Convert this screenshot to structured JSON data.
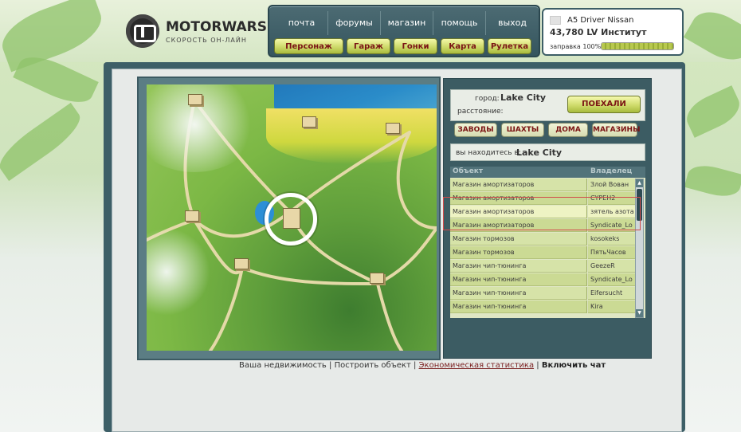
{
  "logo": {
    "title": "MOTORWARS.RU",
    "subtitle": "СКОРОСТЬ ОН-ЛАЙН"
  },
  "nav": {
    "top": [
      "почта",
      "форумы",
      "магазин",
      "помощь",
      "выход"
    ],
    "bottom": [
      "Персонаж",
      "Гараж",
      "Гонки",
      "Карта",
      "Рулетка"
    ]
  },
  "player": {
    "car": "A5 Driver Nissan",
    "money": "43,780 LV Институт",
    "fuel_label": "заправка 100%",
    "fuel_percent": 100
  },
  "city": {
    "city_label": "город:",
    "city_value": "Lake City",
    "distance_label": "расстояние:",
    "go_button": "ПОЕХАЛИ"
  },
  "categories": [
    "ЗАВОДЫ",
    "ШАХТЫ",
    "ДОМА",
    "МАГАЗИНЫ"
  ],
  "location": {
    "label": "вы находитесь в:",
    "value": "Lake City"
  },
  "table": {
    "headers": {
      "object": "Объект",
      "owner": "Владелец"
    },
    "rows": [
      {
        "object": "Магазин амортизаторов",
        "owner": "Злой Вован"
      },
      {
        "object": "Магазин амортизаторов",
        "owner": "CYPEH2"
      },
      {
        "object": "Магазин амортизаторов",
        "owner": "зятель азота"
      },
      {
        "object": "Магазин амортизаторов",
        "owner": "Syndicate_Lo"
      },
      {
        "object": "Магазин тормозов",
        "owner": "kosokeks"
      },
      {
        "object": "Магазин тормозов",
        "owner": "ПятьЧасов"
      },
      {
        "object": "Магазин чип-тюнинга",
        "owner": "GeezeR"
      },
      {
        "object": "Магазин чип-тюнинга",
        "owner": "Syndicate_Lo"
      },
      {
        "object": "Магазин чип-тюнинга",
        "owner": "Eifersucht"
      },
      {
        "object": "Магазин чип-тюнинга",
        "owner": "Kira"
      }
    ]
  },
  "links": {
    "realty": "Ваша недвижимость",
    "build": "Построить объект",
    "stats": "Экономическая статистика",
    "chat": "Включить чат",
    "sep": "|"
  }
}
